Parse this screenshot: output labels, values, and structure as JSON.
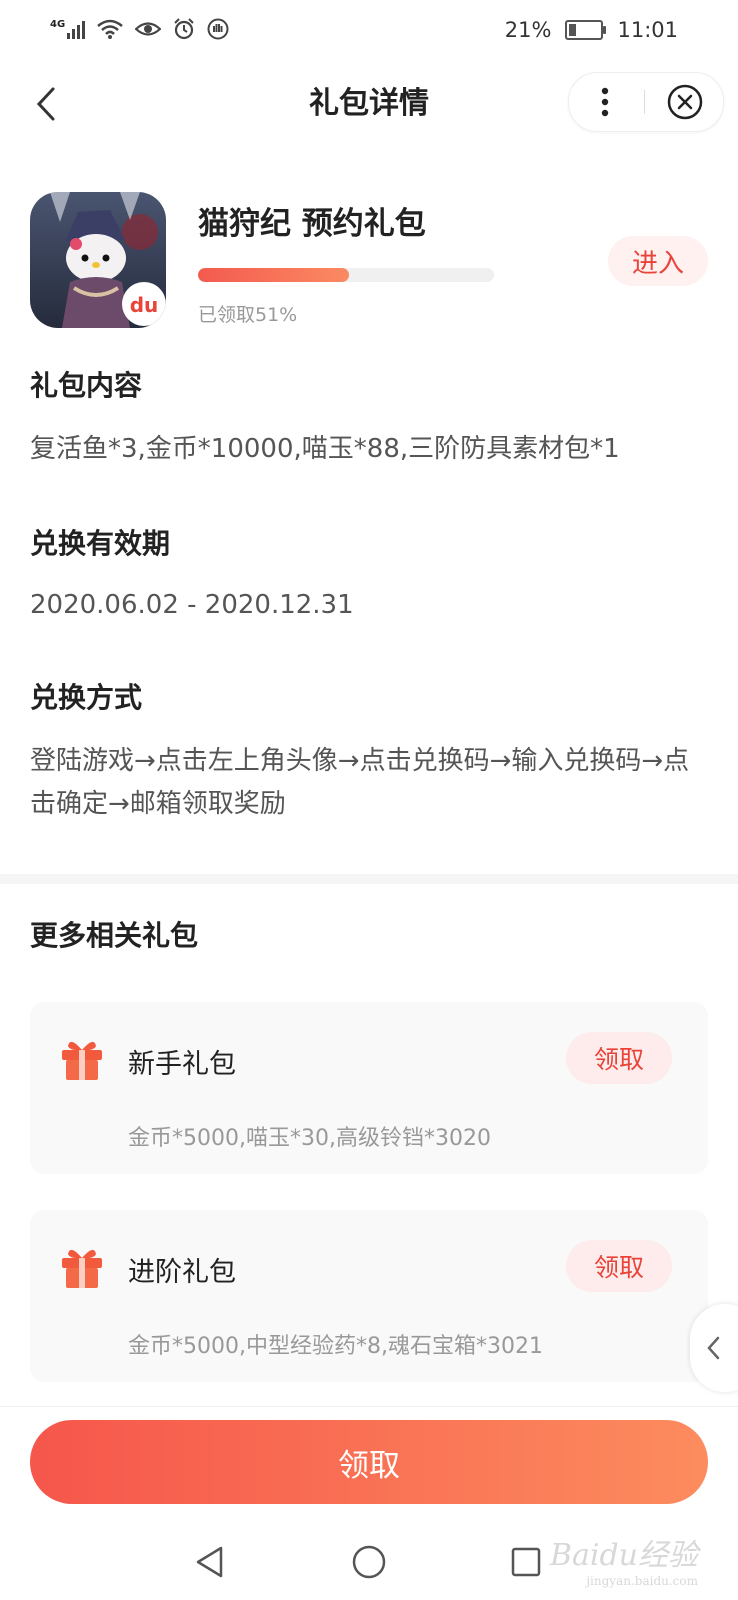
{
  "status_bar": {
    "network": "4G",
    "battery": "21%",
    "time": "11:01"
  },
  "header": {
    "title": "礼包详情",
    "back_icon": "back-chevron-icon",
    "more_icon": "more-vertical-icon",
    "close_icon": "close-circle-icon"
  },
  "game": {
    "name": "猫狩纪 预约礼包",
    "progress": 0.51,
    "claimed_text": "已领取51%",
    "enter_label": "进入",
    "badge_text": "du"
  },
  "sections": {
    "content_title": "礼包内容",
    "content_body": "复活鱼*3,金币*10000,喵玉*88,三阶防具素材包*1",
    "validity_title": "兑换有效期",
    "validity_body": "2020.06.02 - 2020.12.31",
    "method_title": "兑换方式",
    "method_body": "登陆游戏→点击左上角头像→点击兑换码→输入兑换码→点击确定→邮箱领取奖励"
  },
  "related": {
    "title": "更多相关礼包",
    "items": [
      {
        "name": "新手礼包",
        "button": "领取",
        "desc": "金币*5000,喵玉*30,高级铃铛*3020"
      },
      {
        "name": "进阶礼包",
        "button": "领取",
        "desc": "金币*5000,中型经验药*8,魂石宝箱*3021"
      }
    ]
  },
  "footer": {
    "claim_label": "领取"
  },
  "watermark": {
    "brand": "Baidu经验",
    "url": "jingyan.baidu.com"
  },
  "colors": {
    "accent": "#f35a4f",
    "accent_light": "#fdeceb"
  }
}
